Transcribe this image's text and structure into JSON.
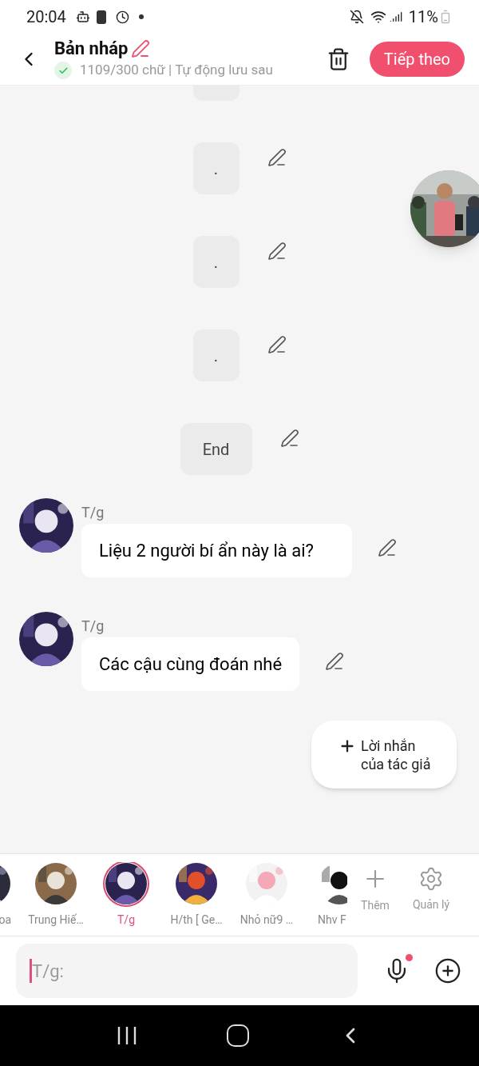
{
  "status_bar": {
    "time": "20:04",
    "battery": "11%"
  },
  "header": {
    "title": "Bản nháp",
    "subtitle": "1109/300 chữ | Tự động lưu sau",
    "next_button": "Tiếp theo"
  },
  "messages": [
    {
      "kind": "partial"
    },
    {
      "kind": "narration",
      "text": "."
    },
    {
      "kind": "narration",
      "text": "."
    },
    {
      "kind": "narration",
      "text": "."
    },
    {
      "kind": "narration",
      "text": "End"
    },
    {
      "kind": "character",
      "name": "T/g",
      "text": "Liệu 2 người bí ẩn này là ai?"
    },
    {
      "kind": "character",
      "name": "T/g",
      "text": "Các cậu cùng đoán nhé"
    }
  ],
  "author_note_button": "Lời nhắn của tác giả",
  "characters": [
    {
      "name": "oa",
      "selected": false
    },
    {
      "name": "Trung Hiế…",
      "selected": false
    },
    {
      "name": "T/g",
      "selected": true
    },
    {
      "name": "H/th [ Ge…",
      "selected": false
    },
    {
      "name": "Nhỏ nữ9  …",
      "selected": false
    },
    {
      "name": "Nhv F",
      "selected": false
    }
  ],
  "character_actions": [
    {
      "kind": "add",
      "label": "Thêm"
    },
    {
      "kind": "settings",
      "label": "Quản lý"
    }
  ],
  "composer": {
    "placeholder": "T/g:",
    "mic_dot": true
  }
}
